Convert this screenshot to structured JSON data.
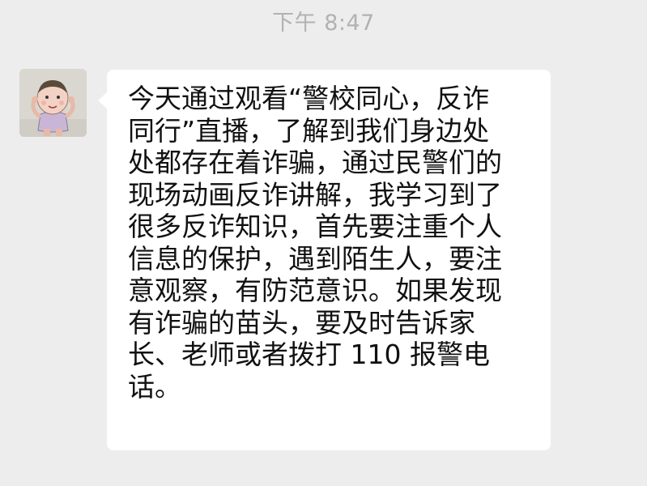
{
  "chat": {
    "timestamp": "下午 8:47",
    "messages": [
      {
        "sender_avatar_icon": "cartoon-child-avatar-icon",
        "text": "今天通过观看“警校同心，反诈\n同行”直播，了解到我们身边处\n处都存在着诈骗，通过民警们的\n现场动画反诈讲解，我学习到了\n很多反诈知识，首先要注重个人\n信息的保护，遇到陌生人，要注\n意观察，有防范意识。如果发现\n有诈骗的苗头，要及时告诉家\n长、老师或者拨打 110 报警电\n话。"
      }
    ]
  },
  "colors": {
    "background": "#ededed",
    "bubble": "#ffffff",
    "timestamp_text": "#b2b2b2",
    "message_text": "#111111"
  }
}
